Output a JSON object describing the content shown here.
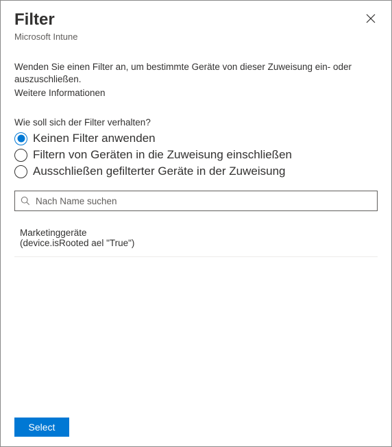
{
  "header": {
    "title": "Filter",
    "subtitle": "Microsoft Intune"
  },
  "body": {
    "description": "Wenden Sie einen Filter an, um bestimmte Geräte von dieser Zuweisung ein- oder auszuschließen.",
    "more_info": "Weitere Informationen",
    "question": "Wie soll sich der Filter verhalten?",
    "radio": {
      "selected_index": 0,
      "options": [
        "Keinen Filter anwenden",
        "Filtern von Geräten in die Zuweisung einschließen",
        "Ausschließen gefilterter Geräte in der Zuweisung"
      ]
    },
    "search_placeholder": "Nach Name suchen",
    "filters": [
      {
        "name": "Marketinggeräte",
        "expression": "(device.isRooted ael \"True\")"
      }
    ]
  },
  "footer": {
    "select_label": "Select"
  }
}
